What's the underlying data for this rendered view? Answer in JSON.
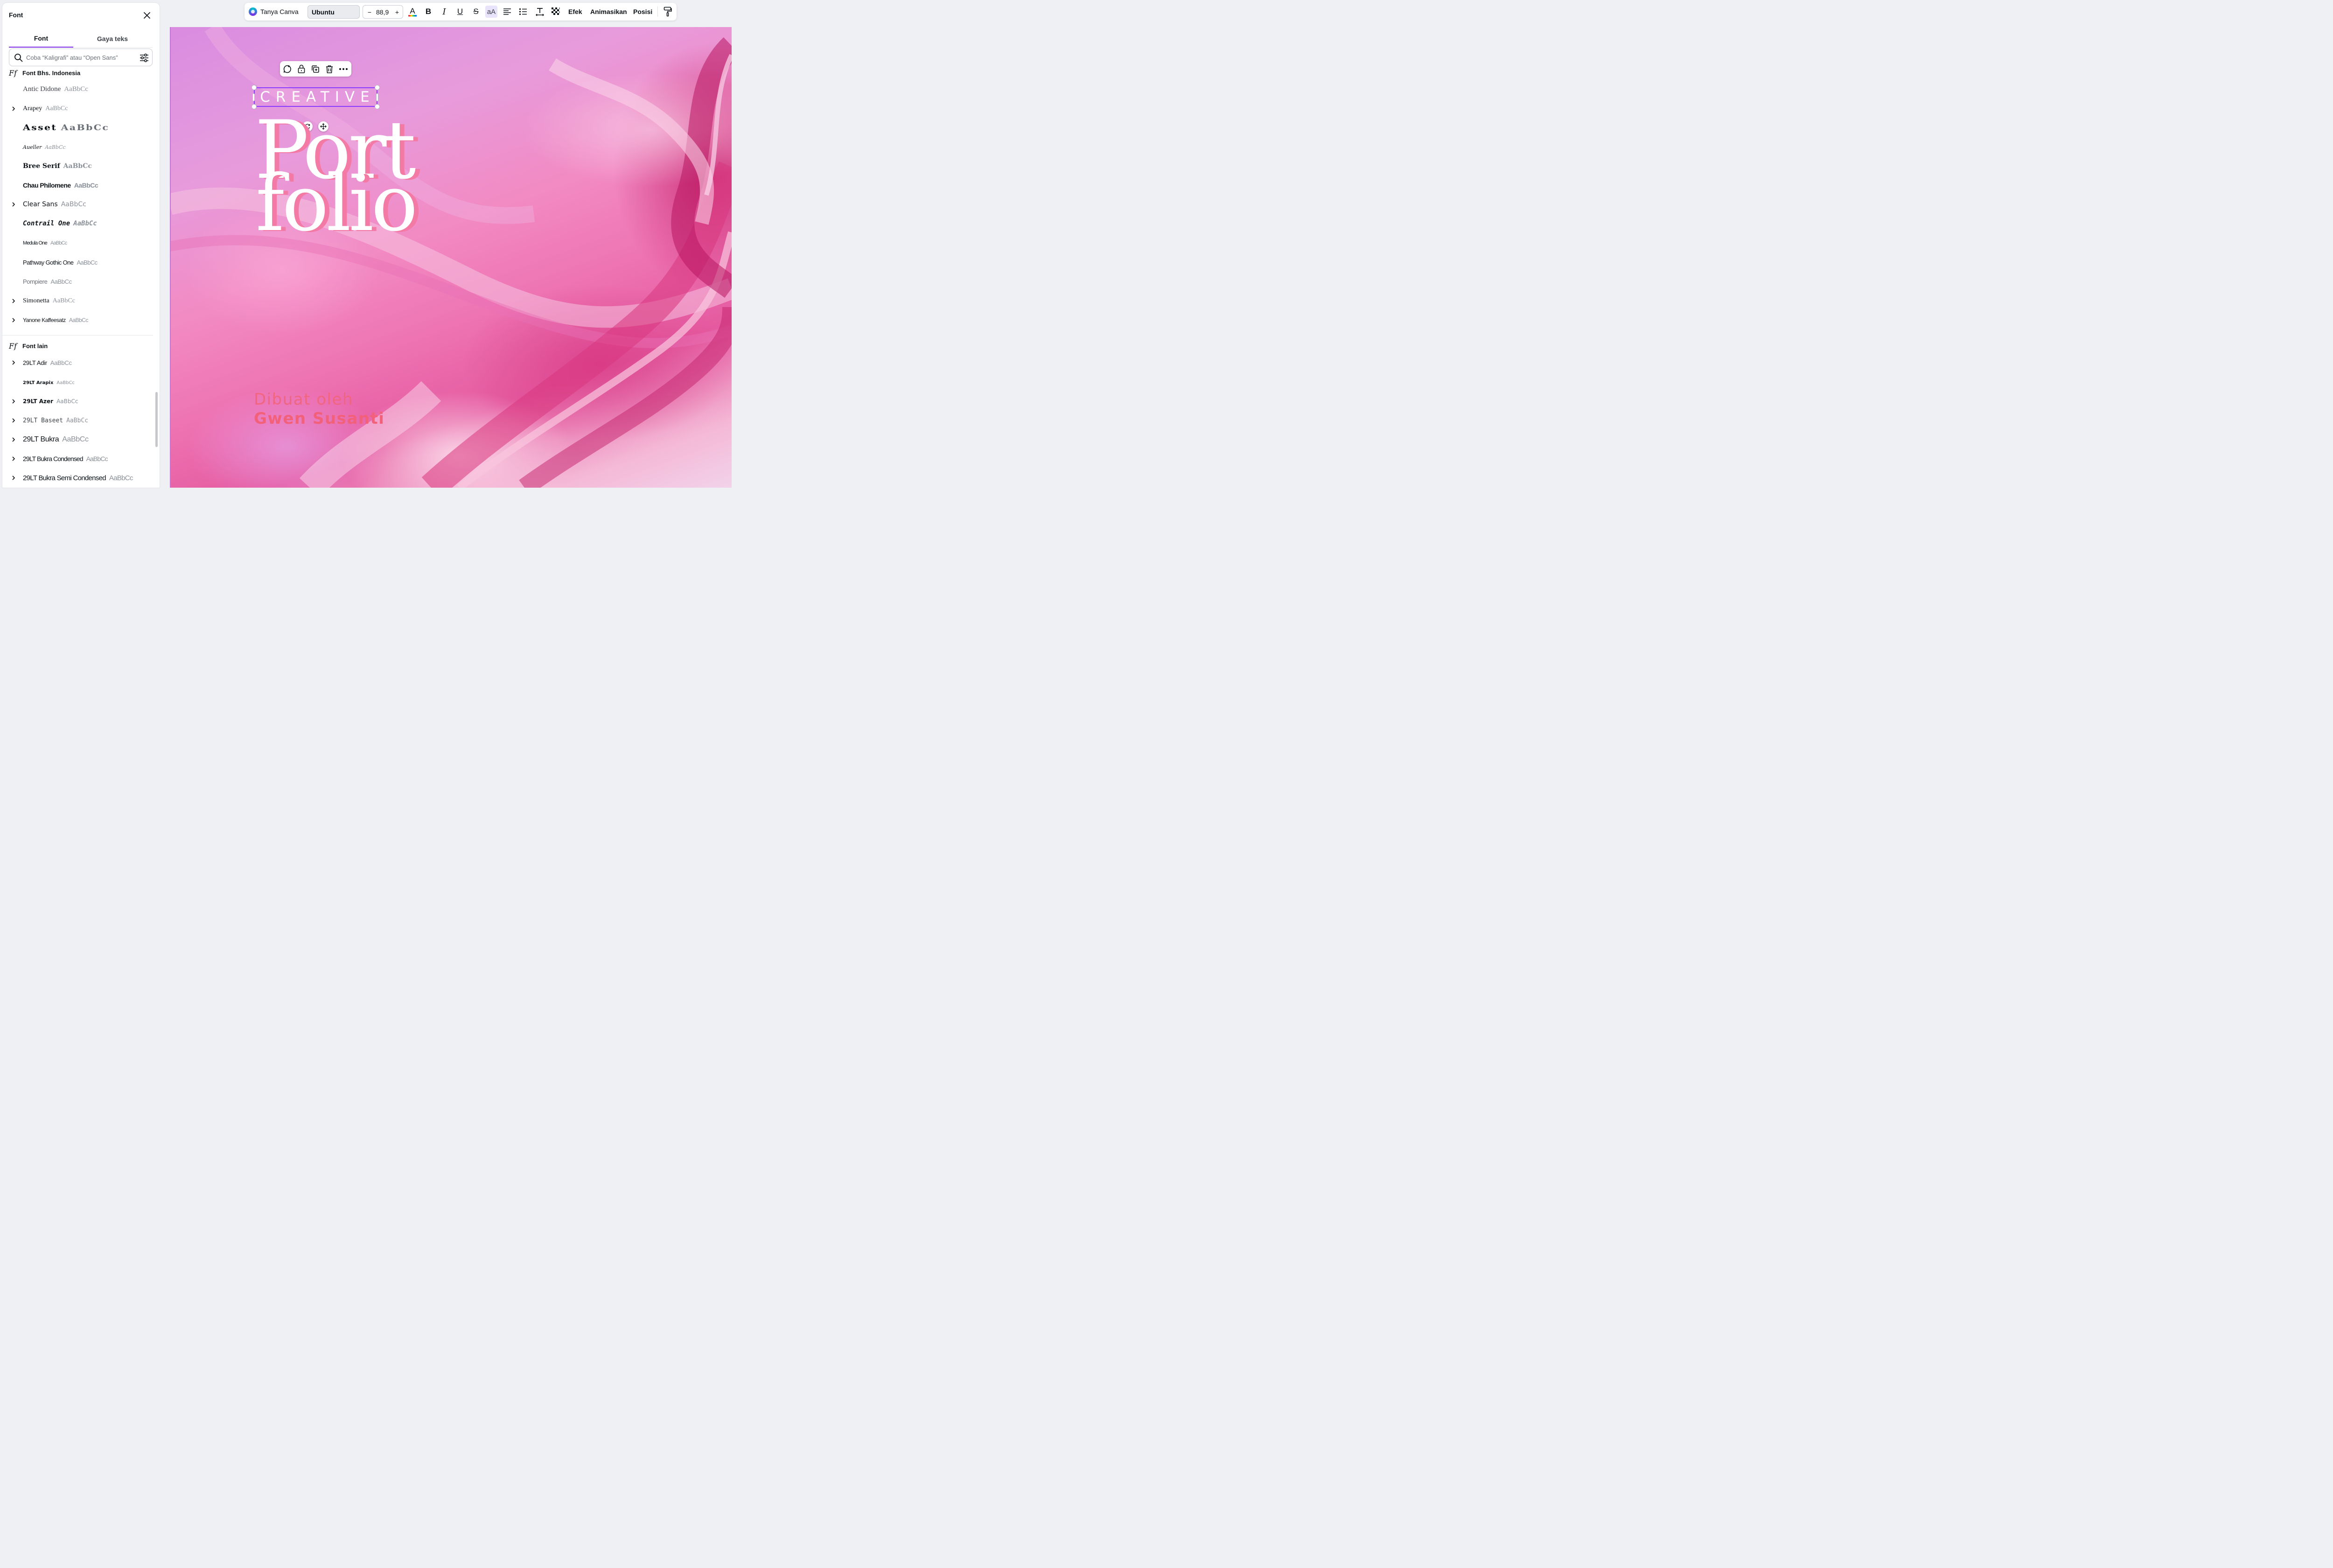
{
  "panel": {
    "title": "Font",
    "tabs": [
      {
        "label": "Font"
      },
      {
        "label": "Gaya teks"
      }
    ],
    "search_placeholder": "Coba “Kaligrafi” atau “Open Sans”",
    "section_indonesia": "Font Bhs. Indonesia",
    "section_other": "Font lain",
    "ff_glyph": "Ff",
    "sample": "AaBbCc",
    "indonesia_fonts": [
      {
        "name": "Antic Didone"
      },
      {
        "name": "Arapey"
      },
      {
        "name": "Asset"
      },
      {
        "name": "Aueller"
      },
      {
        "name": "Bree Serif"
      },
      {
        "name": "Chau Philomene"
      },
      {
        "name": "Clear Sans"
      },
      {
        "name": "Contrail One"
      },
      {
        "name": "Medula One"
      },
      {
        "name": "Pathway Gothic One"
      },
      {
        "name": "Pompiere"
      },
      {
        "name": "Simonetta"
      },
      {
        "name": "Yanone Kaffeesatz"
      }
    ],
    "other_fonts": [
      {
        "name": "29LT Adir"
      },
      {
        "name": "29LT Arapix"
      },
      {
        "name": "29LT Azer"
      },
      {
        "name": "29LT Baseet"
      },
      {
        "name": "29LT Bukra"
      },
      {
        "name": "29LT Bukra Condensed"
      },
      {
        "name": "29LT Bukra Semi Condensed"
      }
    ]
  },
  "toolbar": {
    "assistant": "Tanya Canva",
    "font": "Ubuntu",
    "size_minus": "−",
    "size": "88,9",
    "size_plus": "+",
    "color_letter": "A",
    "bold": "B",
    "italic": "I",
    "underline": "U",
    "strike": "S",
    "case": "aA",
    "effects": "Efek",
    "animate": "Animasikan",
    "position": "Posisi"
  },
  "canvas": {
    "creative": "CREATIVE",
    "portfolio_line1": "Port",
    "portfolio_line2": "folio",
    "byline_label": "Dibuat oleh",
    "byline_name": "Gwen Susanti"
  },
  "colors": {
    "accent": "#8b3dff",
    "byline": "#f1657f",
    "title_shadow": "#f47aa6"
  }
}
